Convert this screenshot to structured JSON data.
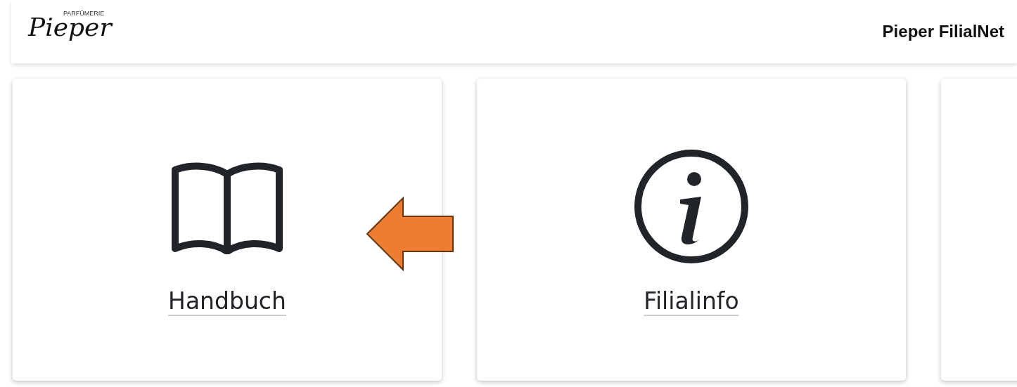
{
  "header": {
    "logo": {
      "small": "PARFÜMERIE",
      "name": "Pieper"
    },
    "title": "Pieper FilialNet"
  },
  "cards": [
    {
      "kind": "book",
      "label": "Handbuch"
    },
    {
      "kind": "info",
      "label": "Filialinfo"
    },
    {
      "kind": "empty"
    }
  ],
  "annotation": {
    "kind": "arrow-left",
    "color": "#ed7d31"
  }
}
